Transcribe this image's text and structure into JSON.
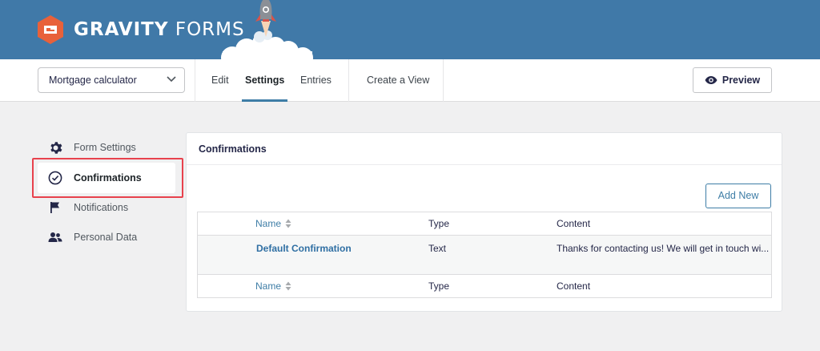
{
  "brand": {
    "logo_bold": "GRAVITY",
    "logo_light": "FORMS",
    "primary_color": "#4079a8",
    "accent_color": "#3e7da6",
    "highlight_color": "#e8424d"
  },
  "toolbar": {
    "form_select_value": "Mortgage calculator",
    "tabs": [
      {
        "label": "Edit",
        "active": false
      },
      {
        "label": "Settings",
        "active": true
      },
      {
        "label": "Entries",
        "active": false
      },
      {
        "label": "Create a View",
        "active": false
      }
    ],
    "preview_label": "Preview"
  },
  "sidebar": {
    "items": [
      {
        "label": "Form Settings",
        "icon": "gear-icon",
        "active": false
      },
      {
        "label": "Confirmations",
        "icon": "check-circle-icon",
        "active": true
      },
      {
        "label": "Notifications",
        "icon": "flag-icon",
        "active": false
      },
      {
        "label": "Personal Data",
        "icon": "users-icon",
        "active": false
      }
    ]
  },
  "panel": {
    "title": "Confirmations",
    "add_new_label": "Add New",
    "columns": {
      "name": "Name",
      "type": "Type",
      "content": "Content"
    },
    "rows": [
      {
        "name": "Default Confirmation",
        "type": "Text",
        "content": "Thanks for contacting us! We will get in touch wi..."
      }
    ]
  }
}
